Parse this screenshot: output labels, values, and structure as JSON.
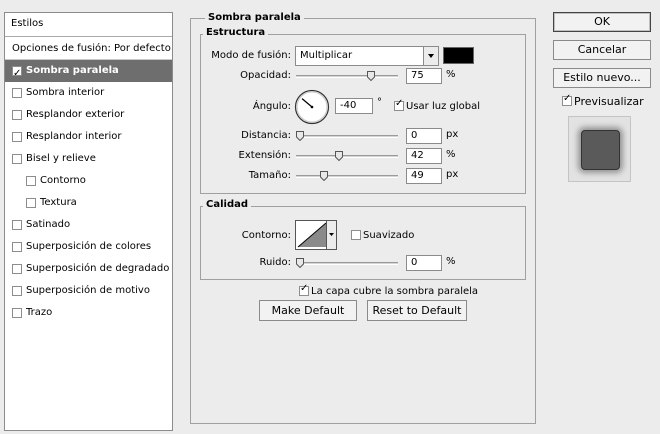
{
  "styles_panel": {
    "header": "Estilos",
    "blending_options": "Opciones de fusión: Por defecto",
    "items": [
      {
        "label": "Sombra paralela",
        "checked": true,
        "selected": true
      },
      {
        "label": "Sombra interior",
        "checked": false
      },
      {
        "label": "Resplandor exterior",
        "checked": false
      },
      {
        "label": "Resplandor interior",
        "checked": false
      },
      {
        "label": "Bisel y relieve",
        "checked": false
      },
      {
        "label": "Contorno",
        "checked": false,
        "indent": true
      },
      {
        "label": "Textura",
        "checked": false,
        "indent": true
      },
      {
        "label": "Satinado",
        "checked": false
      },
      {
        "label": "Superposición de colores",
        "checked": false
      },
      {
        "label": "Superposición de degradado",
        "checked": false
      },
      {
        "label": "Superposición de motivo",
        "checked": false
      },
      {
        "label": "Trazo",
        "checked": false
      }
    ]
  },
  "drop_shadow": {
    "title": "Sombra paralela",
    "structure": {
      "title": "Estructura",
      "blend_mode_label": "Modo de fusión:",
      "blend_mode_value": "Multiplicar",
      "shadow_color": "#000000",
      "opacity_label": "Opacidad:",
      "opacity_value": "75",
      "opacity_fraction": 0.75,
      "opacity_unit": "%",
      "angle_label": "Ángulo:",
      "angle_value": "-40",
      "angle_degrees": -40,
      "angle_unit": "°",
      "global_light_label": "Usar luz global",
      "global_light_checked": true,
      "distance_label": "Distancia:",
      "distance_value": "0",
      "distance_fraction": 0.0,
      "distance_unit": "px",
      "spread_label": "Extensión:",
      "spread_value": "42",
      "spread_fraction": 0.42,
      "spread_unit": "%",
      "size_label": "Tamaño:",
      "size_value": "49",
      "size_fraction": 0.25,
      "size_unit": "px"
    },
    "quality": {
      "title": "Calidad",
      "contour_label": "Contorno:",
      "antialiased_label": "Suavizado",
      "antialiased_checked": false,
      "noise_label": "Ruido:",
      "noise_value": "0",
      "noise_fraction": 0.0,
      "noise_unit": "%"
    },
    "knockout_label": "La capa cubre la sombra paralela",
    "knockout_checked": true,
    "make_default": "Make Default",
    "reset_default": "Reset to Default"
  },
  "dialog_buttons": {
    "ok": "OK",
    "cancel": "Cancelar",
    "new_style": "Estilo nuevo...",
    "preview_label": "Previsualizar",
    "preview_checked": true
  },
  "colors": {
    "selected_row": "#6e6e6e",
    "preview_swatch": "#5a5a5a"
  }
}
